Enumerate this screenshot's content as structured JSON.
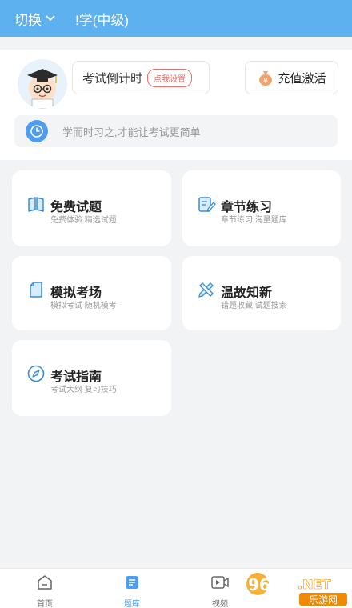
{
  "topbar": {
    "switch_label": "切换",
    "title": "!学(中级)"
  },
  "header": {
    "countdown_label": "考试倒计时",
    "set_badge": "点我设置",
    "recharge_label": "充值激活",
    "motto": "学而时习之,才能让考试更简单"
  },
  "cards": [
    {
      "title": "免费试题",
      "subtitle": "免费体验 精选试题",
      "icon": "book-icon"
    },
    {
      "title": "章节练习",
      "subtitle": "章节练习 海量题库",
      "icon": "edit-note-icon"
    },
    {
      "title": "模拟考场",
      "subtitle": "模拟考试 随机模考",
      "icon": "document-icon"
    },
    {
      "title": "温故知新",
      "subtitle": "错题收藏 试题搜索",
      "icon": "pencil-ruler-icon"
    },
    {
      "title": "考试指南",
      "subtitle": "考试大纲 复习技巧",
      "icon": "compass-icon"
    }
  ],
  "nav": [
    {
      "label": "首页",
      "icon": "home-icon"
    },
    {
      "label": "题库",
      "icon": "question-bank-icon"
    },
    {
      "label": "视频",
      "icon": "video-icon"
    }
  ],
  "watermark": {
    "number": "962",
    "suffix": ".NET",
    "site": "乐游网"
  },
  "colors": {
    "topbar": "#5db1ef",
    "accent": "#4f9df0",
    "badge": "#e86c6c"
  }
}
